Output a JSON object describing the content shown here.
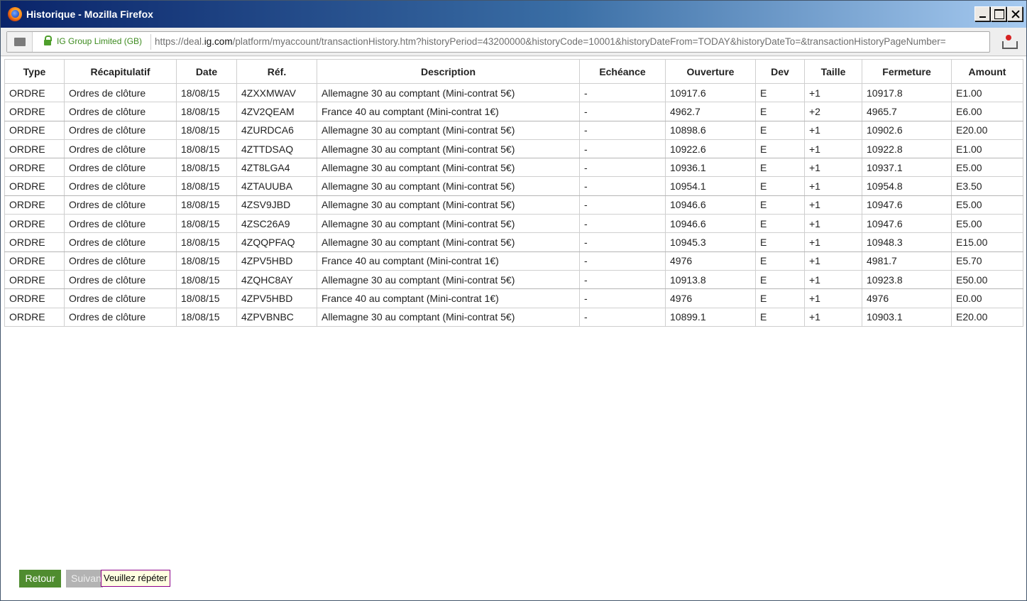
{
  "window": {
    "title": "Historique - Mozilla Firefox",
    "icon": "firefox-icon"
  },
  "urlbar": {
    "identity": "IG Group Limited (GB)",
    "url_prefix": "https://deal.",
    "url_host": "ig.com",
    "url_rest": "/platform/myaccount/transactionHistory.htm?historyPeriod=43200000&historyCode=10001&historyDateFrom=TODAY&historyDateTo=&transactionHistoryPageNumber="
  },
  "table": {
    "headers": [
      "Type",
      "Récapitulatif",
      "Date",
      "Réf.",
      "Description",
      "Echéance",
      "Ouverture",
      "Dev",
      "Taille",
      "Fermeture",
      "Amount"
    ],
    "rows": [
      [
        "ORDRE",
        "Ordres de clôture",
        "18/08/15",
        "4ZXXMWAV",
        "Allemagne 30 au comptant (Mini-contrat 5€)",
        "-",
        "10917.6",
        "E",
        "+1",
        "10917.8",
        "E1.00"
      ],
      [
        "ORDRE",
        "Ordres de clôture",
        "18/08/15",
        "4ZV2QEAM",
        "France 40 au comptant (Mini-contrat 1€)",
        "-",
        "4962.7",
        "E",
        "+2",
        "4965.7",
        "E6.00"
      ],
      [
        "ORDRE",
        "Ordres de clôture",
        "18/08/15",
        "4ZURDCA6",
        "Allemagne 30 au comptant (Mini-contrat 5€)",
        "-",
        "10898.6",
        "E",
        "+1",
        "10902.6",
        "E20.00"
      ],
      [
        "ORDRE",
        "Ordres de clôture",
        "18/08/15",
        "4ZTTDSAQ",
        "Allemagne 30 au comptant (Mini-contrat 5€)",
        "-",
        "10922.6",
        "E",
        "+1",
        "10922.8",
        "E1.00"
      ],
      [
        "ORDRE",
        "Ordres de clôture",
        "18/08/15",
        "4ZT8LGA4",
        "Allemagne 30 au comptant (Mini-contrat 5€)",
        "-",
        "10936.1",
        "E",
        "+1",
        "10937.1",
        "E5.00"
      ],
      [
        "ORDRE",
        "Ordres de clôture",
        "18/08/15",
        "4ZTAUUBA",
        "Allemagne 30 au comptant (Mini-contrat 5€)",
        "-",
        "10954.1",
        "E",
        "+1",
        "10954.8",
        "E3.50"
      ],
      [
        "ORDRE",
        "Ordres de clôture",
        "18/08/15",
        "4ZSV9JBD",
        "Allemagne 30 au comptant (Mini-contrat 5€)",
        "-",
        "10946.6",
        "E",
        "+1",
        "10947.6",
        "E5.00"
      ],
      [
        "ORDRE",
        "Ordres de clôture",
        "18/08/15",
        "4ZSC26A9",
        "Allemagne 30 au comptant (Mini-contrat 5€)",
        "-",
        "10946.6",
        "E",
        "+1",
        "10947.6",
        "E5.00"
      ],
      [
        "ORDRE",
        "Ordres de clôture",
        "18/08/15",
        "4ZQQPFAQ",
        "Allemagne 30 au comptant (Mini-contrat 5€)",
        "-",
        "10945.3",
        "E",
        "+1",
        "10948.3",
        "E15.00"
      ],
      [
        "ORDRE",
        "Ordres de clôture",
        "18/08/15",
        "4ZPV5HBD",
        "France 40 au comptant (Mini-contrat 1€)",
        "-",
        "4976",
        "E",
        "+1",
        "4981.7",
        "E5.70"
      ],
      [
        "ORDRE",
        "Ordres de clôture",
        "18/08/15",
        "4ZQHC8AY",
        "Allemagne 30 au comptant (Mini-contrat 5€)",
        "-",
        "10913.8",
        "E",
        "+1",
        "10923.8",
        "E50.00"
      ],
      [
        "ORDRE",
        "Ordres de clôture",
        "18/08/15",
        "4ZPV5HBD",
        "France 40 au comptant (Mini-contrat 1€)",
        "-",
        "4976",
        "E",
        "+1",
        "4976",
        "E0.00"
      ],
      [
        "ORDRE",
        "Ordres de clôture",
        "18/08/15",
        "4ZPVBNBC",
        "Allemagne 30 au comptant (Mini-contrat 5€)",
        "-",
        "10899.1",
        "E",
        "+1",
        "10903.1",
        "E20.00"
      ]
    ]
  },
  "footer": {
    "back_label": "Retour",
    "next_label": "Suivant",
    "tooltip": "Veuillez répéter"
  },
  "colors": {
    "back_button": "#4f8c2f",
    "identity_text": "#3d8b1f"
  }
}
